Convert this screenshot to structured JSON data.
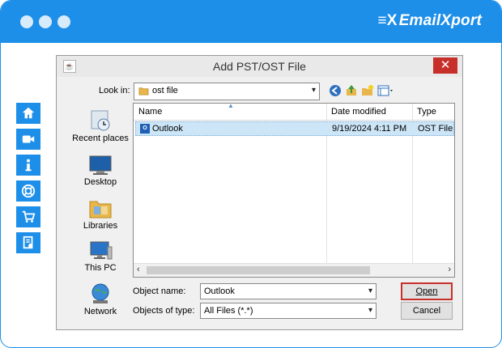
{
  "app": {
    "brand": "EmailXport"
  },
  "sidebar": {
    "items": [
      {
        "icon": "home-icon"
      },
      {
        "icon": "video-icon"
      },
      {
        "icon": "info-icon"
      },
      {
        "icon": "support-icon"
      },
      {
        "icon": "cart-icon"
      },
      {
        "icon": "license-icon"
      }
    ]
  },
  "dialog": {
    "title": "Add PST/OST File",
    "lookin_label": "Look in:",
    "lookin_value": "ost file",
    "places": [
      "Recent places",
      "Desktop",
      "Libraries",
      "This PC",
      "Network"
    ],
    "columns": [
      "Name",
      "Date modified",
      "Type"
    ],
    "files": [
      {
        "name": "Outlook",
        "date": "9/19/2024 4:11 PM",
        "type": "OST File"
      }
    ],
    "object_name_label": "Object name:",
    "object_name_value": "Outlook",
    "object_type_label": "Objects of type:",
    "object_type_value": "All Files (*.*)",
    "open_label": "Open",
    "cancel_label": "Cancel"
  }
}
